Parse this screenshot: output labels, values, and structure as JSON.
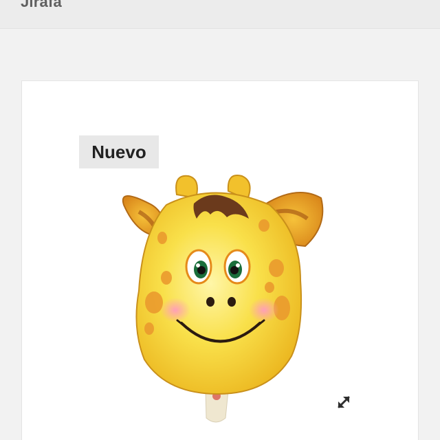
{
  "header": {
    "title": "Jirafa"
  },
  "product": {
    "badge_label": "Nuevo",
    "image_subject": "giraffe-head-balloon",
    "expand_icon": "expand-arrows-icon"
  },
  "colors": {
    "header_bg": "#ececec",
    "page_bg": "#f2f2f2",
    "card_bg": "#ffffff",
    "badge_bg": "#e8e8e8",
    "balloon_yellow": "#f7d21f",
    "balloon_orange": "#e8961e",
    "mane_brown": "#6b3a1c"
  }
}
